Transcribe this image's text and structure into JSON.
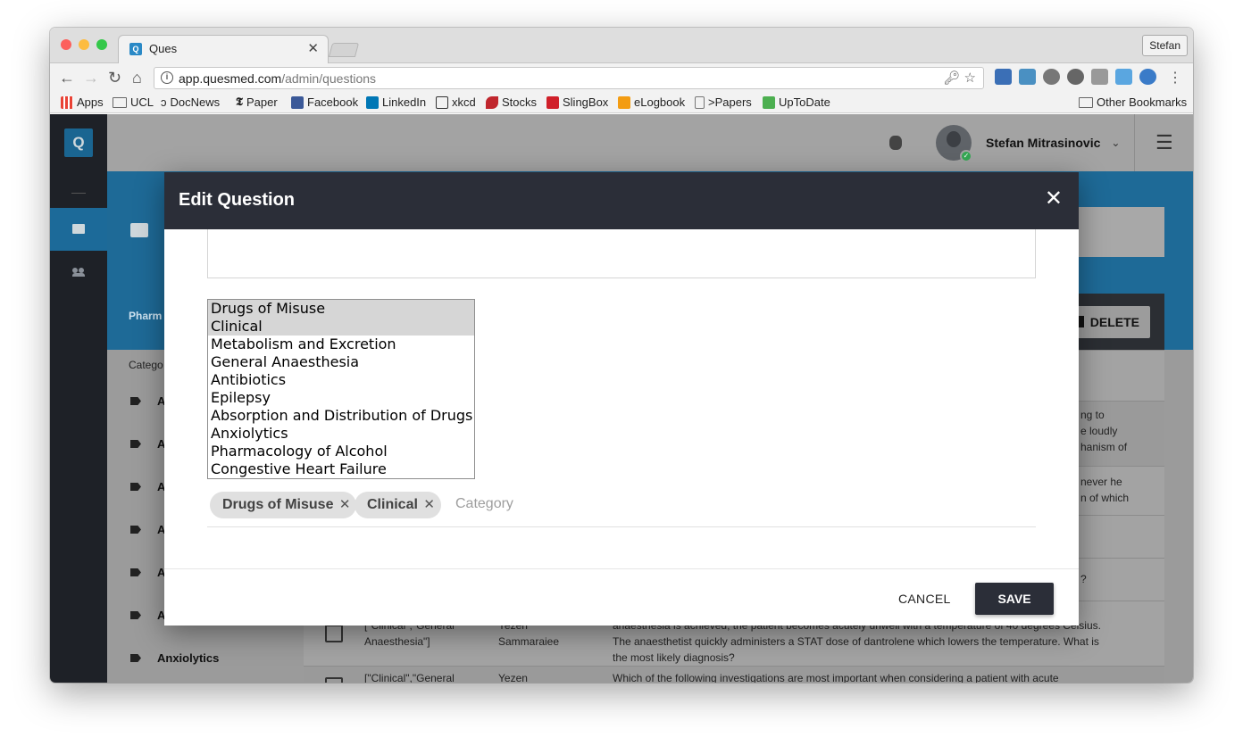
{
  "browser": {
    "tab_title": "Ques",
    "profile_name": "Stefan",
    "url_host": "app.quesmed.com",
    "url_path": "/admin/questions",
    "bookmarks": [
      {
        "label": "Apps",
        "icon": "apps-grid-icon"
      },
      {
        "label": "UCL",
        "icon": "folder-icon"
      },
      {
        "label": "DocNews",
        "icon": "docnews-icon"
      },
      {
        "label": "Paper",
        "icon": "nyt-icon"
      },
      {
        "label": "Facebook",
        "icon": "facebook-icon"
      },
      {
        "label": "LinkedIn",
        "icon": "linkedin-icon"
      },
      {
        "label": "xkcd",
        "icon": "xkcd-icon"
      },
      {
        "label": "Stocks",
        "icon": "stocks-icon"
      },
      {
        "label": "SlingBox",
        "icon": "slingbox-icon"
      },
      {
        "label": "eLogbook",
        "icon": "elogbook-icon"
      },
      {
        "label": ">Papers",
        "icon": "page-icon"
      },
      {
        "label": "UpToDate",
        "icon": "uptodate-icon"
      }
    ],
    "other_bookmarks": "Other Bookmarks"
  },
  "app": {
    "logo": "Q",
    "user_name": "Stefan Mitrasinovic",
    "header_partial": "Pharm",
    "categories_heading_partial": "Catego",
    "delete_label": "DELETE",
    "categories": [
      {
        "label": "A"
      },
      {
        "label": "A"
      },
      {
        "label": "A"
      },
      {
        "label": "A"
      },
      {
        "label": "A"
      },
      {
        "label": "A"
      },
      {
        "label": "Anxiolytics"
      }
    ],
    "table_rows": [
      {
        "text": "ng to\ne loudly\nhanism of"
      },
      {
        "text": "never he\nn of which"
      },
      {
        "text": ""
      },
      {
        "text": "?"
      },
      {
        "category": "[\"Clinical\",\"General\nAnaesthesia\"]",
        "author": "Yezen\nSammaraiee",
        "text": "er general\nanaesthesia is achieved, the patient becomes acutely unwell with a temperature of 40 degrees Celsius.\nThe anaesthetist quickly administers a STAT dose of dantrolene which lowers the temperature. What is\nthe most likely diagnosis?"
      },
      {
        "category": "[\"Clinical\",\"General",
        "author": "Yezen",
        "text": "Which of the following investigations are most important when considering a patient with acute"
      }
    ]
  },
  "modal": {
    "title": "Edit Question",
    "options": [
      {
        "label": "Drugs of Misuse",
        "selected": true
      },
      {
        "label": "Clinical",
        "selected": true
      },
      {
        "label": "Metabolism and Excretion",
        "selected": false
      },
      {
        "label": "General Anaesthesia",
        "selected": false
      },
      {
        "label": "Antibiotics",
        "selected": false
      },
      {
        "label": "Epilepsy",
        "selected": false
      },
      {
        "label": "Absorption and Distribution of Drugs",
        "selected": false
      },
      {
        "label": "Anxiolytics",
        "selected": false
      },
      {
        "label": "Pharmacology of Alcohol",
        "selected": false
      },
      {
        "label": "Congestive Heart Failure",
        "selected": false
      }
    ],
    "chips": [
      "Drugs of Misuse",
      "Clinical"
    ],
    "chip_placeholder": "Category",
    "cancel_label": "CANCEL",
    "save_label": "SAVE"
  },
  "colors": {
    "modal_header": "#2b2e38",
    "accent_blue": "#1c6a99",
    "online_dot": "#34a853"
  }
}
